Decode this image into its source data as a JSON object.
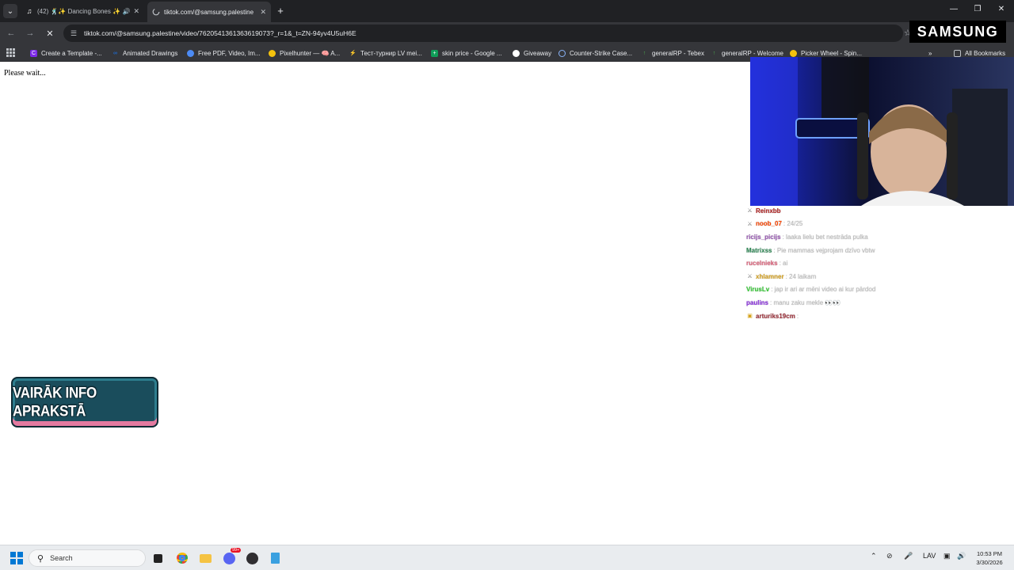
{
  "browser": {
    "tabs": [
      {
        "title": "(42) 🕺✨ Dancing Bones ✨🕺",
        "active": false,
        "audio": true,
        "favicon": "tiktok-icon"
      },
      {
        "title": "tiktok.com/@samsung.palestine",
        "active": true,
        "favicon": "loading-spinner-icon"
      }
    ],
    "new_tab_icon": "+",
    "address": "tiktok.com/@samsung.palestine/video/7620541361363619073?_r=1&_t=ZN-94yv4U5uH6E",
    "bookmarks": [
      {
        "label": "Create a Template -...",
        "icon": "canva-icon",
        "color": "#7d2ae8"
      },
      {
        "label": "Animated Drawings",
        "icon": "meta-icon",
        "color": "#1877f2"
      },
      {
        "label": "Free PDF, Video, Im...",
        "icon": "globe-icon",
        "color": "#4c8bf5"
      },
      {
        "label": "Pixelhunter — 🧠 A...",
        "icon": "bulb-icon",
        "color": "#f4c20d"
      },
      {
        "label": "Тест-турнир LV mei...",
        "icon": "lightning-icon",
        "color": "#f5a623"
      },
      {
        "label": "skin price - Google ...",
        "icon": "sheets-icon",
        "color": "#0f9d58"
      },
      {
        "label": "Giveaway",
        "icon": "discord-icon",
        "color": "#ffffff"
      },
      {
        "label": "Counter-Strike Case...",
        "icon": "globe-icon",
        "color": "#8ab4f8"
      },
      {
        "label": "generalRP - Tebex",
        "icon": "arrow-up-icon",
        "color": "#4caf50"
      },
      {
        "label": "generalRP - Welcome",
        "icon": "arrow-up-icon",
        "color": "#4caf50"
      },
      {
        "label": "Picker Wheel - Spin...",
        "icon": "wheel-icon",
        "color": "#f4c20d"
      }
    ],
    "all_bookmarks": "All Bookmarks"
  },
  "page": {
    "status_text": "Please wait..."
  },
  "overlay": {
    "brand": "SAMSUNG",
    "banner_text": "VAIRĀK INFO APRAKSTĀ",
    "chat": [
      {
        "user": "Reinxbb",
        "message": "",
        "color": "#b22222",
        "badge": "sword-icon"
      },
      {
        "user": "noob_07",
        "message": ": 24/25",
        "color": "#ff4500",
        "badge": "sword-icon"
      },
      {
        "user": "ricijs_picijs",
        "message": ": laaka lielu bet nestrāda pulka",
        "color": "#9b59b6",
        "badge": ""
      },
      {
        "user": "Matrixss",
        "message": ": Pie mammas vejprojam dzīvo vbtw",
        "color": "#2e8b57",
        "badge": ""
      },
      {
        "user": "rucelnieks",
        "message": ": ai",
        "color": "#e0607a",
        "badge": ""
      },
      {
        "user": "xhlamner",
        "message": ": 24 laikam",
        "color": "#daa520",
        "badge": "sword-icon"
      },
      {
        "user": "VirusLv",
        "message": ": jap ir ari ar mēni video ai kur pārdod",
        "color": "#32cd32",
        "badge": ""
      },
      {
        "user": "paulins",
        "message": ": manu zaku mekle 👀👀",
        "color": "#8a2be2",
        "badge": ""
      },
      {
        "user": "arturiks19cm",
        "message": ":",
        "color": "#a0303a",
        "badge": "box-icon"
      }
    ]
  },
  "taskbar": {
    "search_placeholder": "Search",
    "language": "LAV",
    "time": "10:53 PM",
    "date": "3/30/2026",
    "notification_count": "99+"
  }
}
